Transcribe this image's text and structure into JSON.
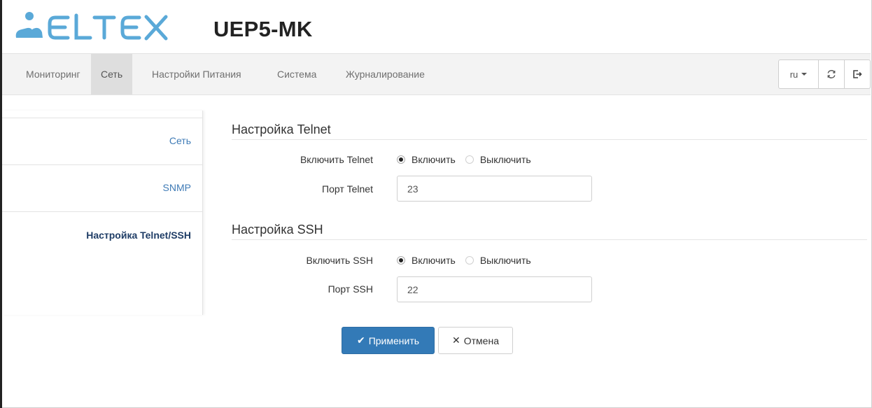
{
  "header": {
    "logo_text": "ELTEX",
    "device_title": "UEP5-MK",
    "brand_color": "#5aa9d8"
  },
  "navbar": {
    "items": [
      {
        "label": "Мониторинг",
        "active": false
      },
      {
        "label": "Сеть",
        "active": true
      },
      {
        "label": "Настройки Питания",
        "active": false
      },
      {
        "label": "Система",
        "active": false
      },
      {
        "label": "Журналирование",
        "active": false
      }
    ],
    "language": "ru",
    "icons": [
      "refresh-icon",
      "logout-icon"
    ]
  },
  "sidebar": {
    "items": [
      {
        "label": "Сеть",
        "active": false
      },
      {
        "label": "SNMP",
        "active": false
      },
      {
        "label": "Настройка Telnet/SSH",
        "active": true
      }
    ]
  },
  "telnet": {
    "title": "Настройка Telnet",
    "enable_label": "Включить Telnet",
    "option_on": "Включить",
    "option_off": "Выключить",
    "enabled": true,
    "port_label": "Порт Telnet",
    "port_value": "23"
  },
  "ssh": {
    "title": "Настройка SSH",
    "enable_label": "Включить SSH",
    "option_on": "Включить",
    "option_off": "Выключить",
    "enabled": true,
    "port_label": "Порт SSH",
    "port_value": "22"
  },
  "actions": {
    "apply_label": "Применить",
    "cancel_label": "Отмена",
    "apply_color": "#337ab7"
  }
}
